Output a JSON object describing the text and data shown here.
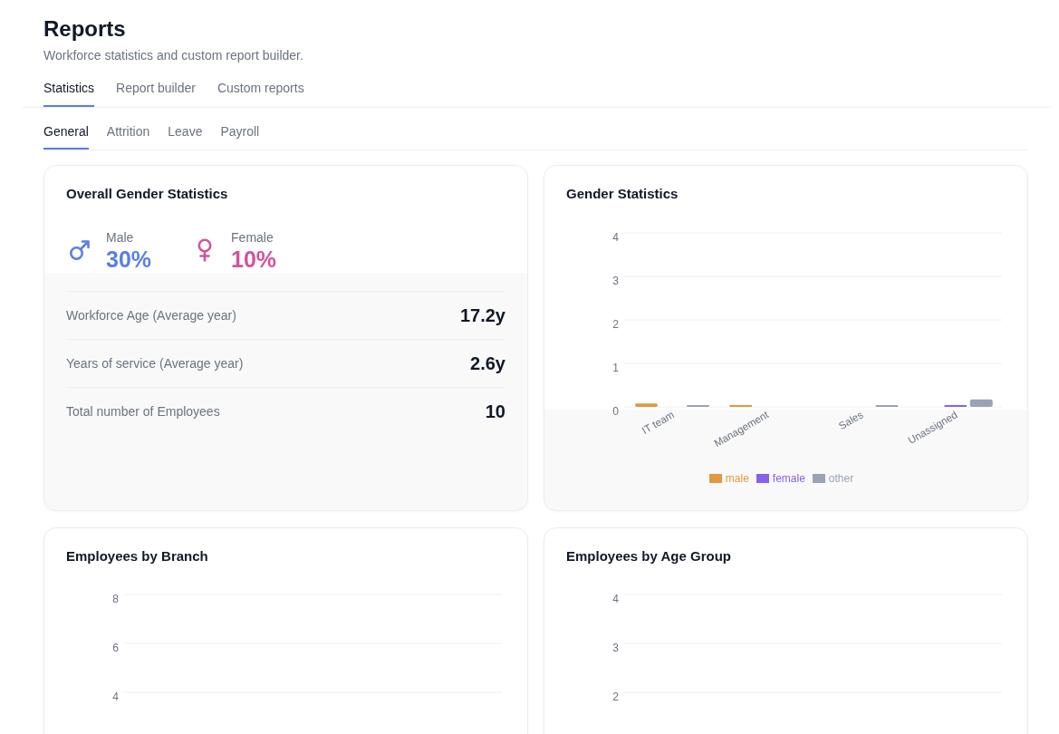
{
  "header": {
    "title": "Reports",
    "subtitle": "Workforce statistics and custom report builder."
  },
  "tabs": [
    {
      "label": "Statistics",
      "selected": true
    },
    {
      "label": "Report builder",
      "selected": false
    },
    {
      "label": "Custom reports",
      "selected": false
    }
  ],
  "subtabs": [
    {
      "label": "General",
      "selected": true
    },
    {
      "label": "Attrition",
      "selected": false
    },
    {
      "label": "Leave",
      "selected": false
    },
    {
      "label": "Payroll",
      "selected": false
    }
  ],
  "cards": [
    {
      "kind": "gender_summary",
      "title": "Overall Gender Statistics",
      "genders": [
        {
          "kind": "male",
          "label": "Male",
          "value": "30%"
        },
        {
          "kind": "female",
          "label": "Female",
          "value": "10%"
        }
      ],
      "stats": [
        {
          "label": "Workforce Age (Average year)",
          "value": "17.2y"
        },
        {
          "label": "Years of service (Average year)",
          "value": "2.6y"
        },
        {
          "label": "Total number of Employees",
          "value": "10"
        }
      ]
    },
    {
      "kind": "chart",
      "title": "Gender Statistics",
      "chart_data": {
        "type": "bar",
        "categories": [
          "IT team",
          "Management",
          "Sales",
          "Unassigned"
        ],
        "series": [
          {
            "name": "male",
            "color": "#e0993f",
            "values": [
              0.08,
              0.04,
              0,
              0
            ]
          },
          {
            "name": "female",
            "color": "#8661ec",
            "values": [
              0,
              0,
              0,
              0.04
            ]
          },
          {
            "name": "other",
            "color": "#9aa3b5",
            "values": [
              0.04,
              0,
              0.04,
              0.17
            ]
          }
        ],
        "ylim": [
          0,
          4
        ],
        "yticks": [
          0,
          1,
          2,
          3,
          4
        ],
        "grid": true,
        "legend": "bottom"
      }
    },
    {
      "kind": "axis_frame",
      "title": "Employees by Branch",
      "axis_labels": [
        "8",
        "6",
        "4"
      ]
    },
    {
      "kind": "axis_frame",
      "title": "Employees by Age Group",
      "axis_labels": [
        "4",
        "3",
        "2"
      ]
    }
  ]
}
